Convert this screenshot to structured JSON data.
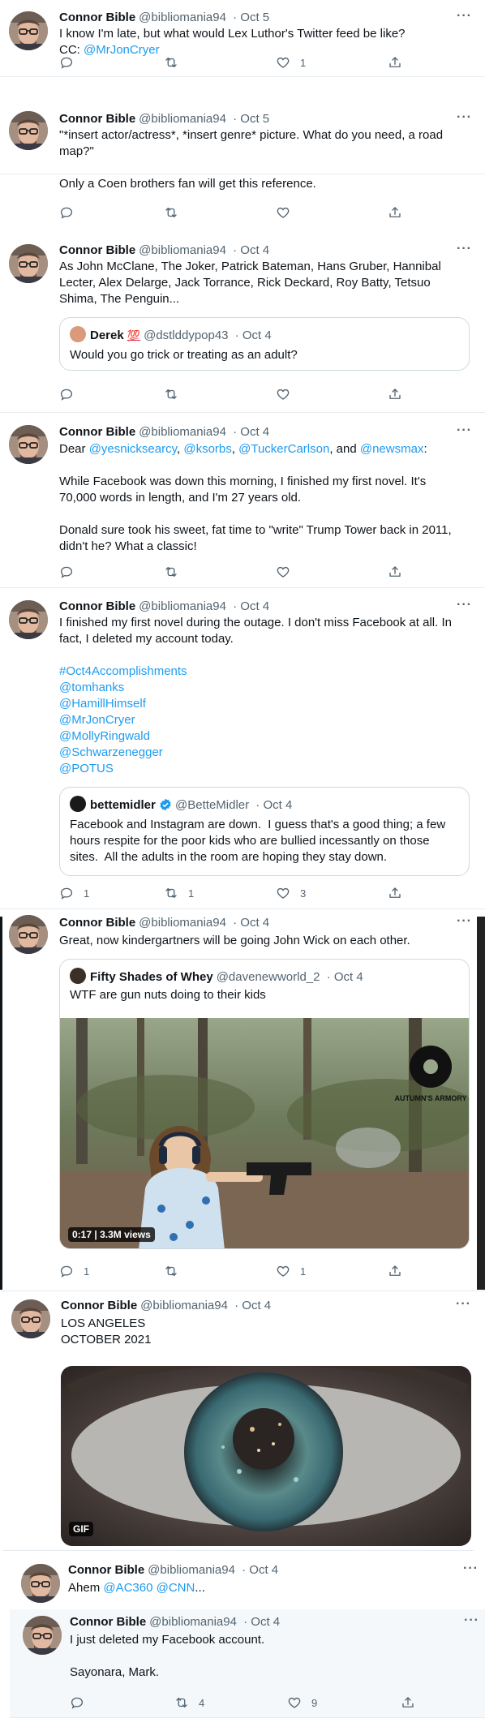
{
  "author": {
    "name": "Connor Bible",
    "handle": "@bibliomania94"
  },
  "tweets": [
    {
      "date": "· Oct 5",
      "text1": "I know I'm late, but what would Lex Luthor's Twitter feed be like?",
      "text2_prefix": "CC: ",
      "text2_link": "@MrJonCryer",
      "likes": "1"
    },
    {
      "date": "· Oct 5",
      "text": "\"*insert actor/actress*, *insert genre* picture. What do you need, a road\nmap?\"\n\nOnly a Coen brothers fan will get this reference."
    },
    {
      "date": "· Oct 4",
      "text": "As John McClane, The Joker, Patrick Bateman, Hans Gruber, Hannibal\nLecter, Alex Delarge, Jack Torrance, Rick Deckard, Roy Batty, Tetsuo\nShima, The Penguin...",
      "quote": {
        "name": "Derek",
        "emoji": "💯",
        "handle": "@dstlddypop43",
        "date": "· Oct 4",
        "text": "Would you go trick or treating as an adult?"
      }
    },
    {
      "date": "· Oct 4",
      "dear": "Dear ",
      "m1": "@yesnicksearcy",
      "c1": ", ",
      "m2": "@ksorbs",
      "c2": ", ",
      "m3": "@TuckerCarlson",
      "c3": ", and ",
      "m4": "@newsmax",
      "c4": ":",
      "text": "While Facebook was down this morning, I finished my first novel. It's\n70,000 words in length, and I'm 27 years old.\n\nDonald sure took his sweet, fat time to \"write\" Trump Tower back in 2011,\ndidn't he? What a classic!"
    },
    {
      "date": "· Oct 4",
      "text": "I finished my first novel during the outage. I don't miss Facebook at all. In\nfact, I deleted my account today.",
      "tags": [
        "#Oct4Accomplishments",
        "@tomhanks",
        "@HamillHimself",
        "@MrJonCryer",
        "@MollyRingwald",
        "@Schwarzenegger",
        "@POTUS"
      ],
      "quote": {
        "name": "bettemidler",
        "handle": "@BetteMidler",
        "date": "· Oct 4",
        "text": "Facebook and Instagram are down.  I guess that's a good thing; a few\nhours respite for the poor kids who are bullied incessantly on those\nsites.  All the adults in the room are hoping they stay down."
      },
      "replies": "1",
      "retweets": "1",
      "likes": "3"
    },
    {
      "date": "· Oct 4",
      "text": "Great, now kindergartners will be going John Wick on each other.",
      "quote": {
        "name": "Fifty Shades of Whey",
        "handle": "@davenewworld_2",
        "date": "· Oct 4",
        "text": "WTF are gun nuts doing to their kids",
        "duration": "0:17",
        "views": "3.3M views",
        "watermark": "AUTUMN'S ARMORY"
      },
      "replies": "1",
      "likes": "1"
    },
    {
      "date": "· Oct 4",
      "text": "LOS ANGELES\nOCTOBER 2021",
      "gif": "GIF"
    },
    {
      "date": "· Oct 4",
      "text_prefix": "Ahem ",
      "m1": "@AC360",
      "sp": " ",
      "m2": "@CNN",
      "suffix": "..."
    },
    {
      "date": "· Oct 4",
      "text": "I just deleted my Facebook account.\n\nSayonara, Mark.",
      "retweets": "4",
      "likes": "9"
    }
  ]
}
